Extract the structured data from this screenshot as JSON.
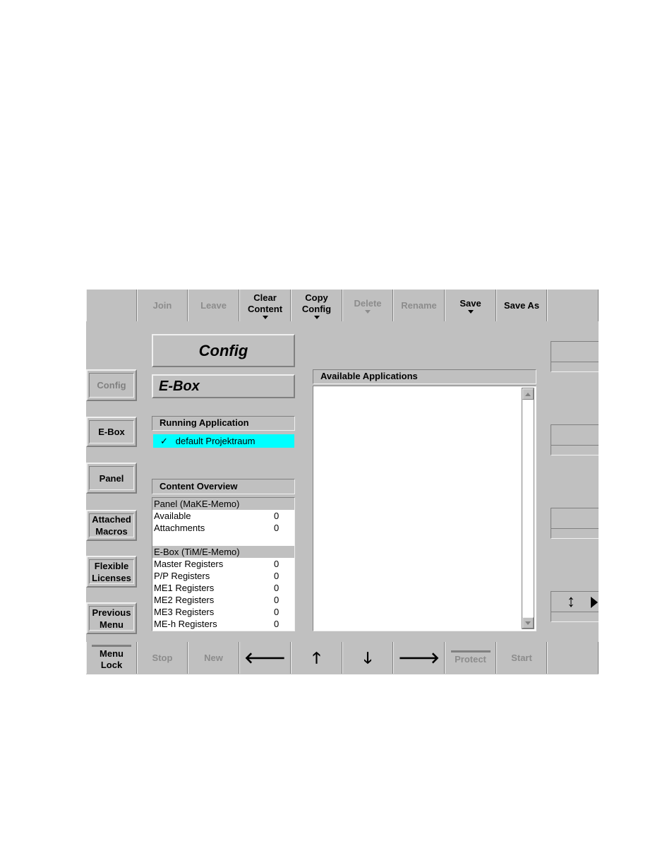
{
  "top_toolbar": [
    {
      "label": "",
      "enabled": false
    },
    {
      "label": "Join",
      "enabled": false
    },
    {
      "label": "Leave",
      "enabled": false
    },
    {
      "label": "Clear Content",
      "enabled": true,
      "dropdown": true
    },
    {
      "label": "Copy Config",
      "enabled": true,
      "dropdown": true
    },
    {
      "label": "Delete",
      "enabled": false,
      "dropdown": true
    },
    {
      "label": "Rename",
      "enabled": false
    },
    {
      "label": "Save",
      "enabled": true,
      "dropdown": true
    },
    {
      "label": "Save As",
      "enabled": true
    },
    {
      "label": "",
      "enabled": false
    }
  ],
  "bottom_toolbar": [
    {
      "label": "Menu Lock",
      "enabled": true,
      "indicator": true
    },
    {
      "label": "Stop",
      "enabled": false
    },
    {
      "label": "New",
      "enabled": false
    },
    {
      "icon": "arrow-left-icon",
      "glyph": "🡐"
    },
    {
      "icon": "arrow-up-icon",
      "glyph": "🡑"
    },
    {
      "icon": "arrow-down-icon",
      "glyph": "🡓"
    },
    {
      "icon": "arrow-right-icon",
      "glyph": "🡒"
    },
    {
      "label": "Protect",
      "enabled": false,
      "indicator": true
    },
    {
      "label": "Start",
      "enabled": false
    },
    {
      "label": "",
      "enabled": false
    }
  ],
  "sidebar": [
    {
      "label": "Config",
      "active": true
    },
    {
      "label": "E-Box"
    },
    {
      "label": "Panel"
    },
    {
      "label": "Attached Macros"
    },
    {
      "label": "Flexible Licenses"
    },
    {
      "label": "Previous Menu"
    }
  ],
  "title": "Config",
  "subtitle": "E-Box",
  "running": {
    "header": "Running Application",
    "check": "✓",
    "item": "default Projektraum",
    "highlight": "#00ffff"
  },
  "overview": {
    "header": "Content Overview",
    "rows": [
      {
        "label": "Panel (MaKE-Memo)",
        "value": "",
        "group": true
      },
      {
        "label": "Available",
        "value": "0"
      },
      {
        "label": "Attachments",
        "value": "0"
      },
      {
        "label": "",
        "value": ""
      },
      {
        "label": "E-Box (TiM/E-Memo)",
        "value": "",
        "group": true
      },
      {
        "label": "Master Registers",
        "value": "0"
      },
      {
        "label": "P/P Registers",
        "value": "0"
      },
      {
        "label": "ME1 Registers",
        "value": "0"
      },
      {
        "label": "ME2 Registers",
        "value": "0"
      },
      {
        "label": "ME3 Registers",
        "value": "0"
      },
      {
        "label": "ME-h Registers",
        "value": "0"
      }
    ]
  },
  "available": {
    "header": "Available Applications",
    "items": []
  },
  "right_panel": {
    "nav_icons": [
      "up-down-arrow-icon",
      "play-right-icon"
    ]
  }
}
